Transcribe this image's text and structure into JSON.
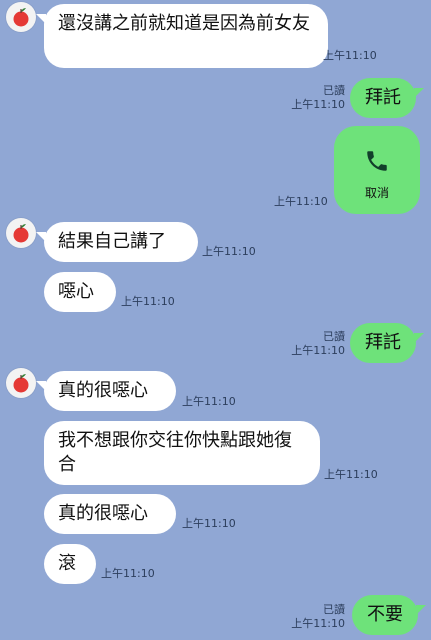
{
  "colors": {
    "background": "#90a7d4",
    "incoming_bubble": "#ffffff",
    "outgoing_bubble": "#6ee27a",
    "text": "#111111",
    "meta_text": "#2c3e5c",
    "apple_red": "#e53935",
    "apple_leaf": "#2e7d32"
  },
  "messages": [
    {
      "text": "還沒講之前就知道是因為前女友",
      "time": "上午11:10",
      "direction": "in"
    },
    {
      "text": "拜託",
      "time": "上午11:10",
      "read": "已讀",
      "direction": "out"
    },
    {
      "text": "取消",
      "time": "上午11:10",
      "direction": "out",
      "type": "call",
      "icon": "phone-icon"
    },
    {
      "text": "結果自己講了",
      "time": "上午11:10",
      "direction": "in"
    },
    {
      "text": "噁心",
      "time": "上午11:10",
      "direction": "in"
    },
    {
      "text": "拜託",
      "time": "上午11:10",
      "read": "已讀",
      "direction": "out"
    },
    {
      "text": "真的很噁心",
      "time": "上午11:10",
      "direction": "in"
    },
    {
      "text": "我不想跟你交往你快點跟她復合",
      "time": "上午11:10",
      "direction": "in"
    },
    {
      "text": "真的很噁心",
      "time": "上午11:10",
      "direction": "in"
    },
    {
      "text": "滾",
      "time": "上午11:10",
      "direction": "in"
    },
    {
      "text": "不要",
      "time": "上午11:10",
      "read": "已讀",
      "direction": "out"
    }
  ],
  "avatar": {
    "icon": "apple-icon"
  }
}
